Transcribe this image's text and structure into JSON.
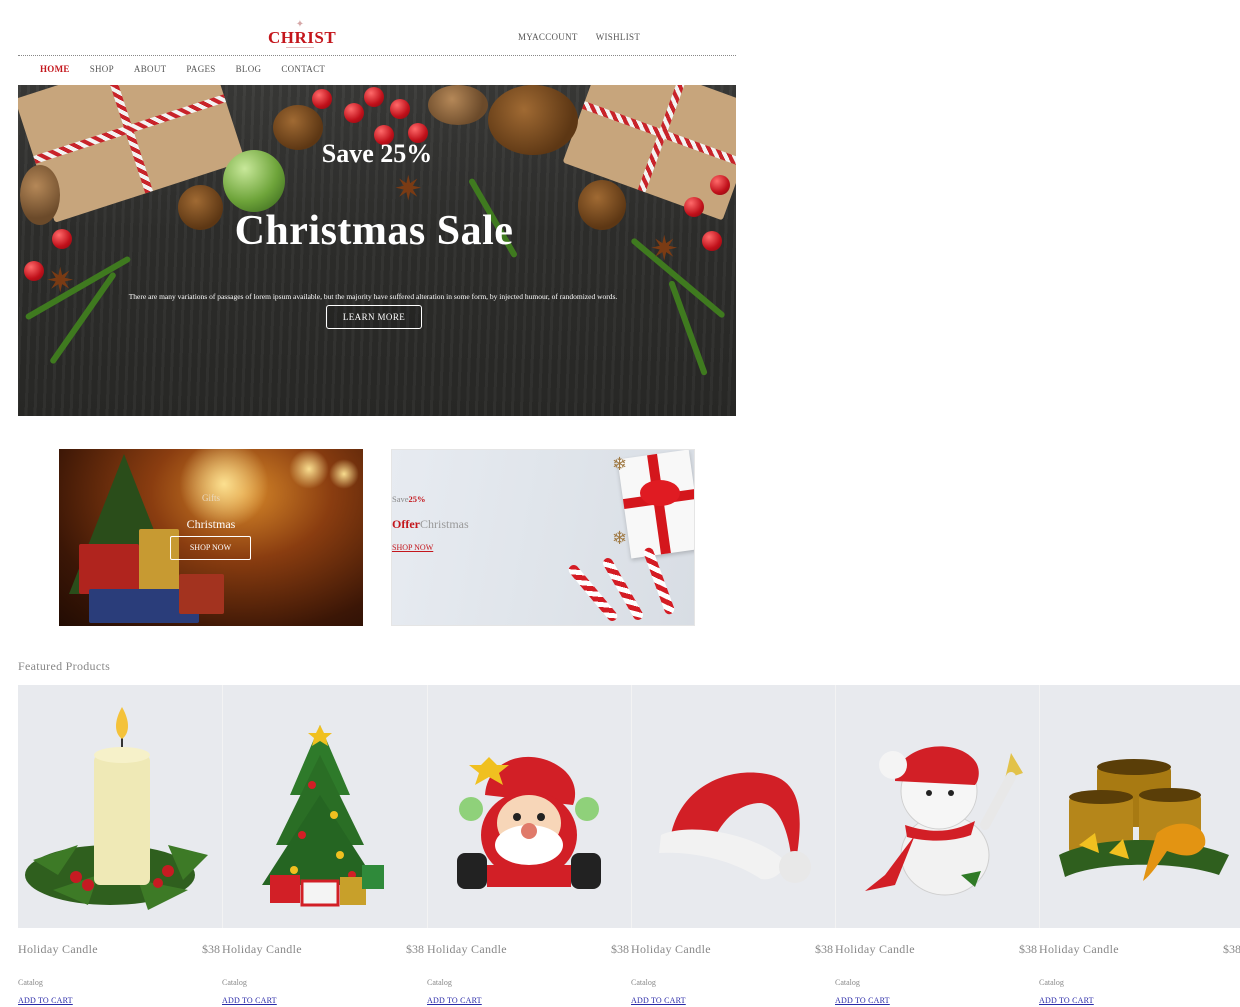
{
  "header": {
    "logo_text": "CHRIST",
    "top_links": [
      "MYACCOUNT",
      "WISHLIST"
    ]
  },
  "nav": {
    "items": [
      "HOME",
      "SHOP",
      "ABOUT",
      "PAGES",
      "BLOG",
      "CONTACT"
    ],
    "active": "HOME",
    "active_color": "#c4161c"
  },
  "hero": {
    "save_text": "Save 25%",
    "title": "Christmas Sale",
    "description": "There are many variations of passages of lorem ipsum available, but the majority have suffered alteration in some form, by injected humour, of randomized words.",
    "button_label": "LEARN MORE"
  },
  "banners": {
    "left": {
      "small_text": "Gifts",
      "big_text": "Christmas",
      "button_label": "SHOP NOW"
    },
    "right": {
      "save_prefix": "Save",
      "save_highlight": "25%",
      "offer_highlight": "Offer",
      "offer_text": "Christmas",
      "link_label": "SHOP NOW"
    }
  },
  "featured": {
    "title": "Featured Products",
    "products": [
      {
        "name": "Holiday Candle",
        "price": "$38",
        "category": "Catalog",
        "cart_label": "ADD TO CART",
        "icon": "candle-icon"
      },
      {
        "name": "Holiday Candle",
        "price": "$38",
        "category": "Catalog",
        "cart_label": "ADD TO CART",
        "icon": "christmas-tree-icon"
      },
      {
        "name": "Holiday Candle",
        "price": "$38",
        "category": "Catalog",
        "cart_label": "ADD TO CART",
        "icon": "santa-icon"
      },
      {
        "name": "Holiday Candle",
        "price": "$38",
        "category": "Catalog",
        "cart_label": "ADD TO CART",
        "icon": "santa-hat-icon"
      },
      {
        "name": "Holiday Candle",
        "price": "$38",
        "category": "Catalog",
        "cart_label": "ADD TO CART",
        "icon": "snowman-icon"
      },
      {
        "name": "Holiday Candle",
        "price": "$38",
        "category": "Catalog",
        "cart_label": "ADD TO CART",
        "icon": "candles-icon"
      }
    ]
  },
  "colors": {
    "brand_red": "#c4161c",
    "product_bg": "#e8eaee",
    "link_blue": "#2a2aa8"
  }
}
